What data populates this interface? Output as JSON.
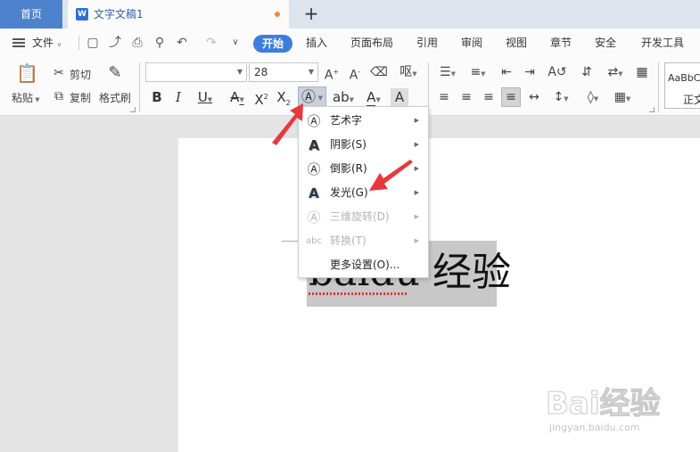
{
  "tabs": {
    "home": "首页",
    "document": "文字文稿1",
    "doc_icon": "W"
  },
  "menu": {
    "file": "文件",
    "items": [
      "开始",
      "插入",
      "页面布局",
      "引用",
      "审阅",
      "视图",
      "章节",
      "安全",
      "开发工具"
    ]
  },
  "ribbon": {
    "paste": "粘贴",
    "cut": "剪切",
    "copy": "复制",
    "format_painter": "格式刷",
    "font_name": "",
    "font_size": "28",
    "style_preview": "AaBbC",
    "style_name": "正文"
  },
  "document": {
    "text": "baidu 经验"
  },
  "dropdown": {
    "items": [
      {
        "label": "艺术字",
        "enabled": true
      },
      {
        "label": "阴影(S)",
        "enabled": true
      },
      {
        "label": "倒影(R)",
        "enabled": true
      },
      {
        "label": "发光(G)",
        "enabled": true
      },
      {
        "label": "三维旋转(D)",
        "enabled": false
      },
      {
        "label": "转换(T)",
        "enabled": false
      },
      {
        "label": "更多设置(O)...",
        "enabled": true
      }
    ]
  },
  "watermark": {
    "brand": "Bai经验",
    "url": "jingyan.baidu.com"
  },
  "colors": {
    "accent": "#3d7de0",
    "home_tab": "#4f82cc",
    "arrow": "#e8383d",
    "font_color_bar": "#1a3fcc"
  }
}
